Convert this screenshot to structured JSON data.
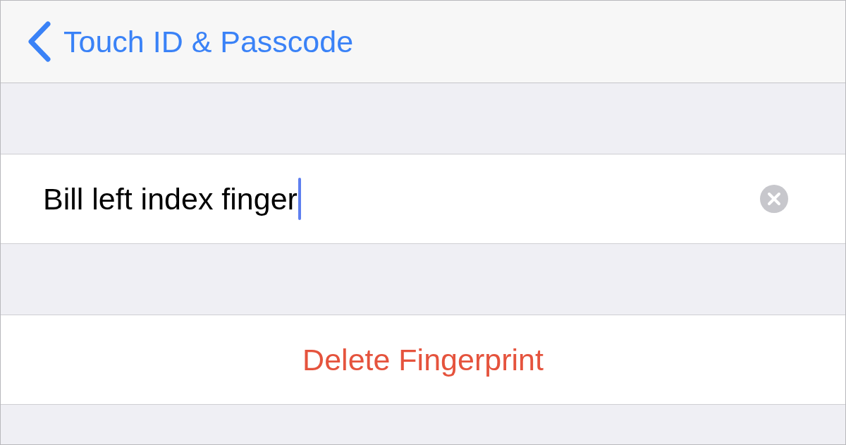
{
  "nav": {
    "back_label": "Touch ID & Passcode"
  },
  "name_field": {
    "value": "Bill left index finger",
    "focused": true
  },
  "delete_button": {
    "label": "Delete Fingerprint"
  }
}
